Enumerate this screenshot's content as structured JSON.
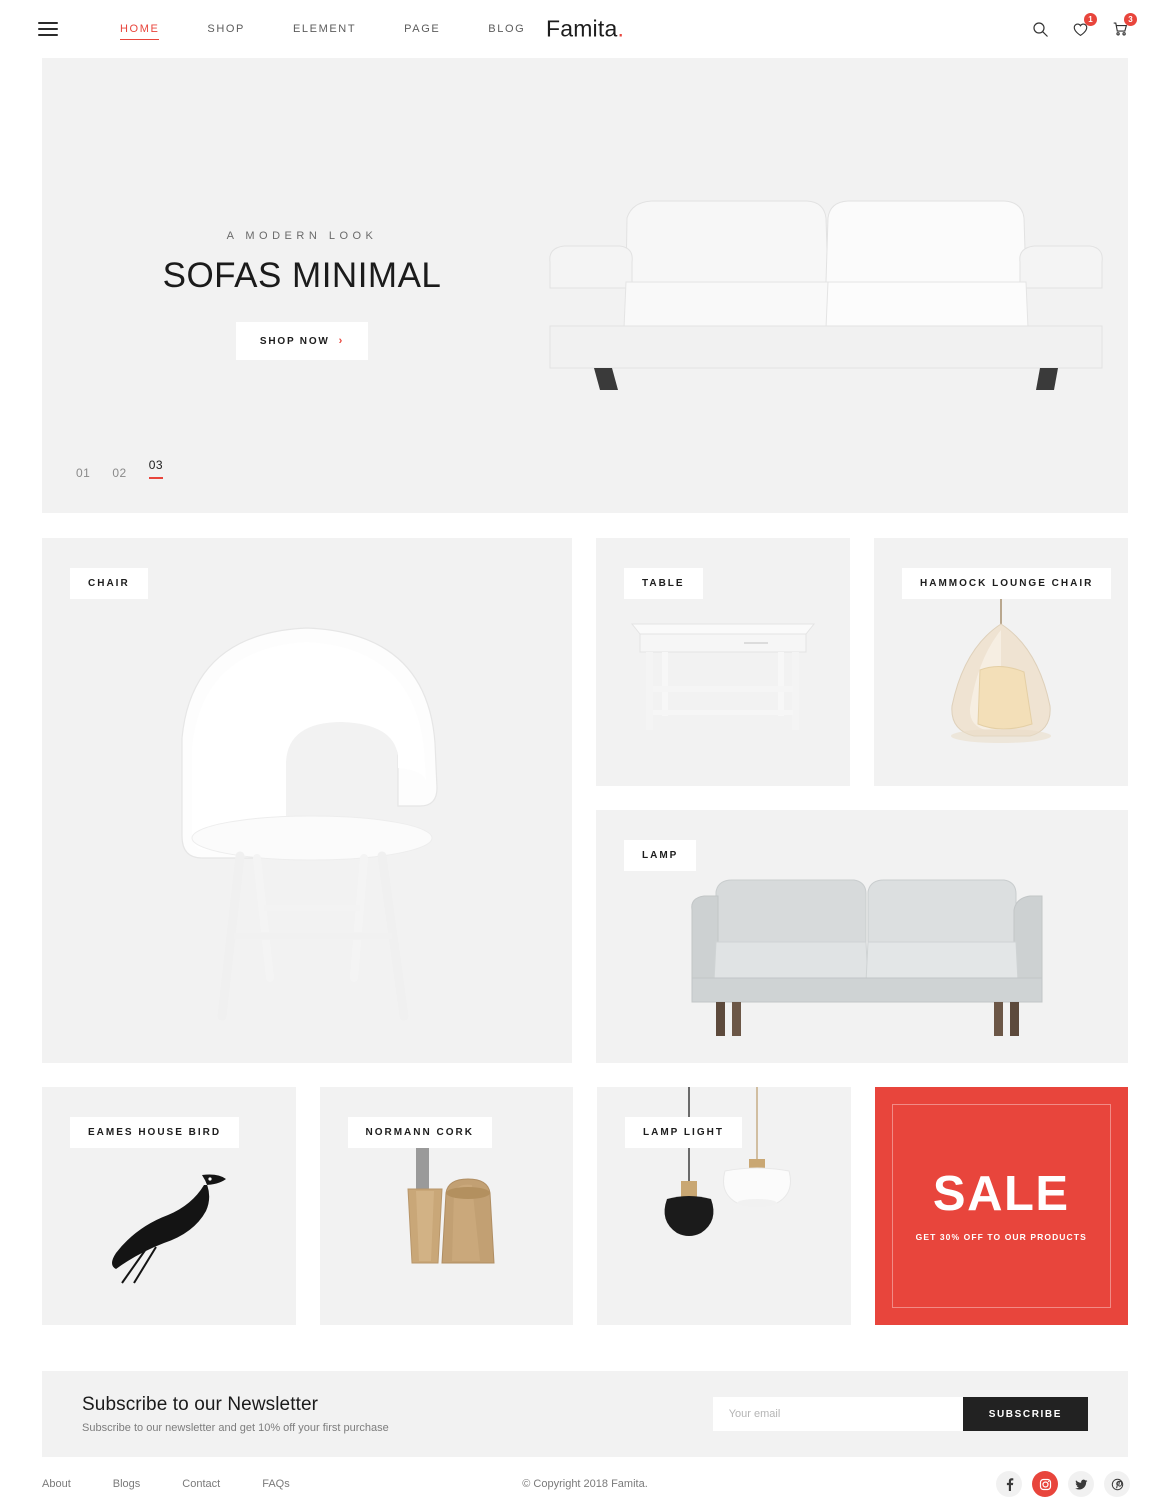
{
  "header": {
    "menu_icon": "hamburger-menu-icon",
    "nav": [
      {
        "label": "HOME",
        "active": true
      },
      {
        "label": "SHOP",
        "active": false
      },
      {
        "label": "ELEMENT",
        "active": false
      },
      {
        "label": "PAGE",
        "active": false
      },
      {
        "label": "BLOG",
        "active": false
      }
    ],
    "logo": "Famita",
    "logo_dot": ".",
    "icons": {
      "search": "search-icon",
      "wishlist": "heart-icon",
      "wishlist_count": "1",
      "cart": "cart-icon",
      "cart_count": "3"
    }
  },
  "hero": {
    "subtitle": "A MODERN LOOK",
    "title": "SOFAS MINIMAL",
    "button_label": "SHOP NOW",
    "button_chevron": "›",
    "slides": [
      {
        "label": "01",
        "active": false
      },
      {
        "label": "02",
        "active": false
      },
      {
        "label": "03",
        "active": true
      }
    ]
  },
  "categories": {
    "chair": "CHAIR",
    "table": "TABLE",
    "hammock": "HAMMOCK LOUNGE CHAIR",
    "lamp": "LAMP",
    "bird": "EAMES HOUSE BIRD",
    "cork": "NORMANN CORK",
    "lamp_light": "LAMP LIGHT"
  },
  "sale": {
    "title": "SALE",
    "subtitle": "GET 30% OFF TO OUR PRODUCTS"
  },
  "newsletter": {
    "title": "Subscribe to our Newsletter",
    "subtitle": "Subscribe to our newsletter and get 10% off your first purchase",
    "input_placeholder": "Your email",
    "input_value": "",
    "button_label": "SUBSCRIBE"
  },
  "footer": {
    "links": [
      {
        "label": "About"
      },
      {
        "label": "Blogs"
      },
      {
        "label": "Contact"
      },
      {
        "label": "FAQs"
      }
    ],
    "copyright": "© Copyright 2018 Famita.",
    "socials": [
      {
        "name": "facebook-icon",
        "active": false
      },
      {
        "name": "instagram-icon",
        "active": true
      },
      {
        "name": "twitter-icon",
        "active": false
      },
      {
        "name": "pinterest-icon",
        "active": false
      }
    ]
  },
  "colors": {
    "accent": "#e8453c",
    "panel": "#f2f2f2",
    "dark": "#222222"
  }
}
